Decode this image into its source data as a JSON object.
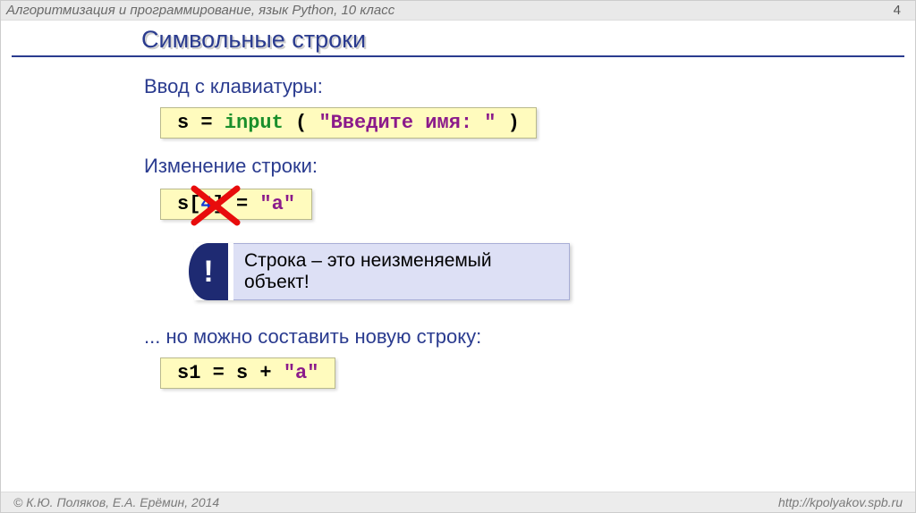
{
  "header": {
    "course": "Алгоритмизация и программирование, язык Python, 10 класс",
    "page_number": "4"
  },
  "title": "Символьные строки",
  "section_input": {
    "heading": "Ввод с клавиатуры:",
    "code": {
      "s": "s",
      "eq": " = ",
      "input_kw": "input",
      "open": " ( ",
      "prompt": "\"Введите имя: \"",
      "close": " )"
    }
  },
  "section_change": {
    "heading": "Изменение строки:",
    "code": {
      "s": "s",
      "br_open": "[",
      "index": "4",
      "br_close": "]",
      "eq": " = ",
      "val": "\"a\""
    }
  },
  "callout": {
    "icon": "!",
    "text": "Строка – это неизменяемый объект!"
  },
  "section_newstr": {
    "heading": "... но можно составить новую строку:",
    "code": {
      "s1": "s1",
      "eq": " = ",
      "s": "s",
      "plus": " + ",
      "val": "\"a\""
    }
  },
  "footer": {
    "left": "© К.Ю. Поляков, Е.А. Ерёмин, 2014",
    "right": "http://kpolyakov.spb.ru"
  }
}
